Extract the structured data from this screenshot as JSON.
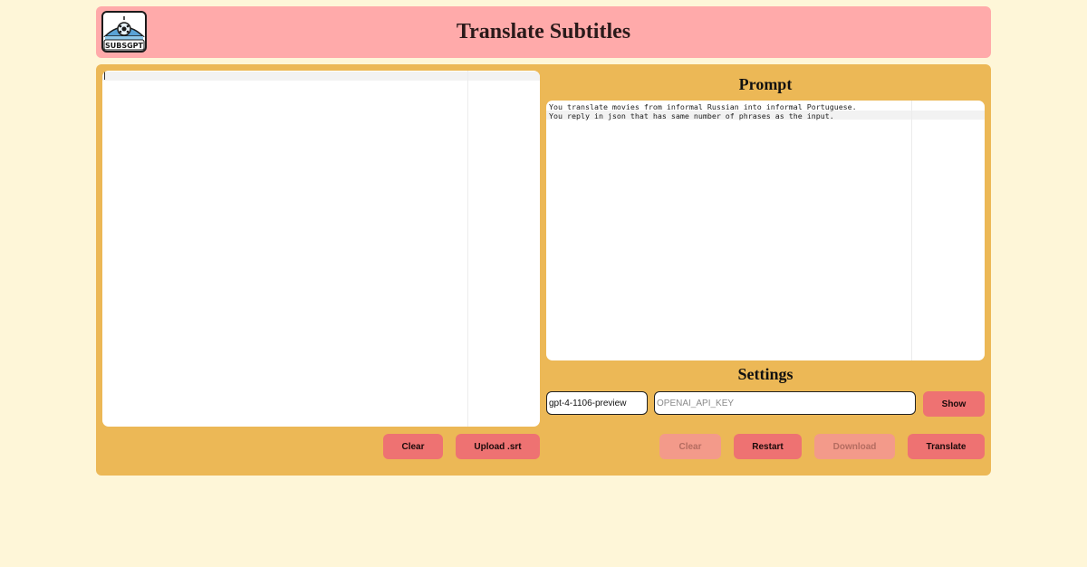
{
  "header": {
    "title": "Translate Subtitles",
    "logo_text": "SUBSGPT"
  },
  "subtitle_editor": {
    "content": ""
  },
  "prompt": {
    "title": "Prompt",
    "content": "You translate movies from informal Russian into informal Portuguese.\nYou reply in json that has same number of phrases as the input."
  },
  "settings": {
    "title": "Settings",
    "model_value": "gpt-4-1106-preview",
    "api_key_placeholder": "OPENAI_API_KEY",
    "show_label": "Show"
  },
  "left_actions": {
    "clear_label": "Clear",
    "upload_label": "Upload .srt"
  },
  "right_actions": {
    "clear_label": "Clear",
    "restart_label": "Restart",
    "download_label": "Download",
    "translate_label": "Translate"
  },
  "colors": {
    "background": "#fef6d8",
    "header": "#ffaaaa",
    "panel": "#ecb856",
    "button": "#ee7272"
  }
}
